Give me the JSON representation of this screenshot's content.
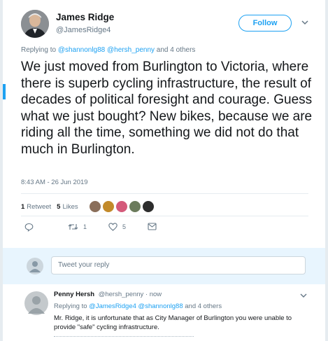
{
  "tweet": {
    "author_name": "James Ridge",
    "author_handle": "@JamesRidge4",
    "follow_label": "Follow",
    "replying_prefix": "Replying to",
    "replying_mentions": [
      "@shannonlg88",
      "@hersh_penny"
    ],
    "replying_suffix": "and 4 others",
    "text": "We just moved from Burlington to Victoria, where there is superb cycling infrastructure, the result of decades of political foresight and courage. Guess what we just bought? New bikes, because we are riding all the time, something we did not do that much in Burlington.",
    "timestamp": "8:43 AM - 26 Jun 2019",
    "retweets_count": "1",
    "retweets_label": "Retweet",
    "likes_count": "5",
    "likes_label": "Likes",
    "likers": [
      {
        "icon": "liker-avatar-1",
        "color": "#8a6e5a"
      },
      {
        "icon": "liker-avatar-2",
        "color": "#c28a2a"
      },
      {
        "icon": "liker-avatar-3",
        "color": "#d45a7a"
      },
      {
        "icon": "liker-avatar-4",
        "color": "#6b7b5c"
      },
      {
        "icon": "liker-avatar-5",
        "color": "#2d2d2d"
      }
    ],
    "actions": {
      "reply_count": "",
      "retweet_count": "1",
      "like_count": "5"
    }
  },
  "compose": {
    "placeholder": "Tweet your reply"
  },
  "reply": {
    "author_name": "Penny Hersh",
    "author_handle": "@hersh_penny",
    "time": "· now",
    "replying_prefix": "Replying to",
    "replying_mentions": [
      "@JamesRidge4",
      "@shannonlg88"
    ],
    "replying_suffix": "and 4 others",
    "text": "Mr. Ridge, it is unfortunate that as City Manager of Burlington you were unable to provide \"safe\" cycling infrastructure."
  },
  "colors": {
    "accent": "#1da1f2",
    "secondary_text": "#657786",
    "reply_area_bg": "#e8f5fe"
  }
}
